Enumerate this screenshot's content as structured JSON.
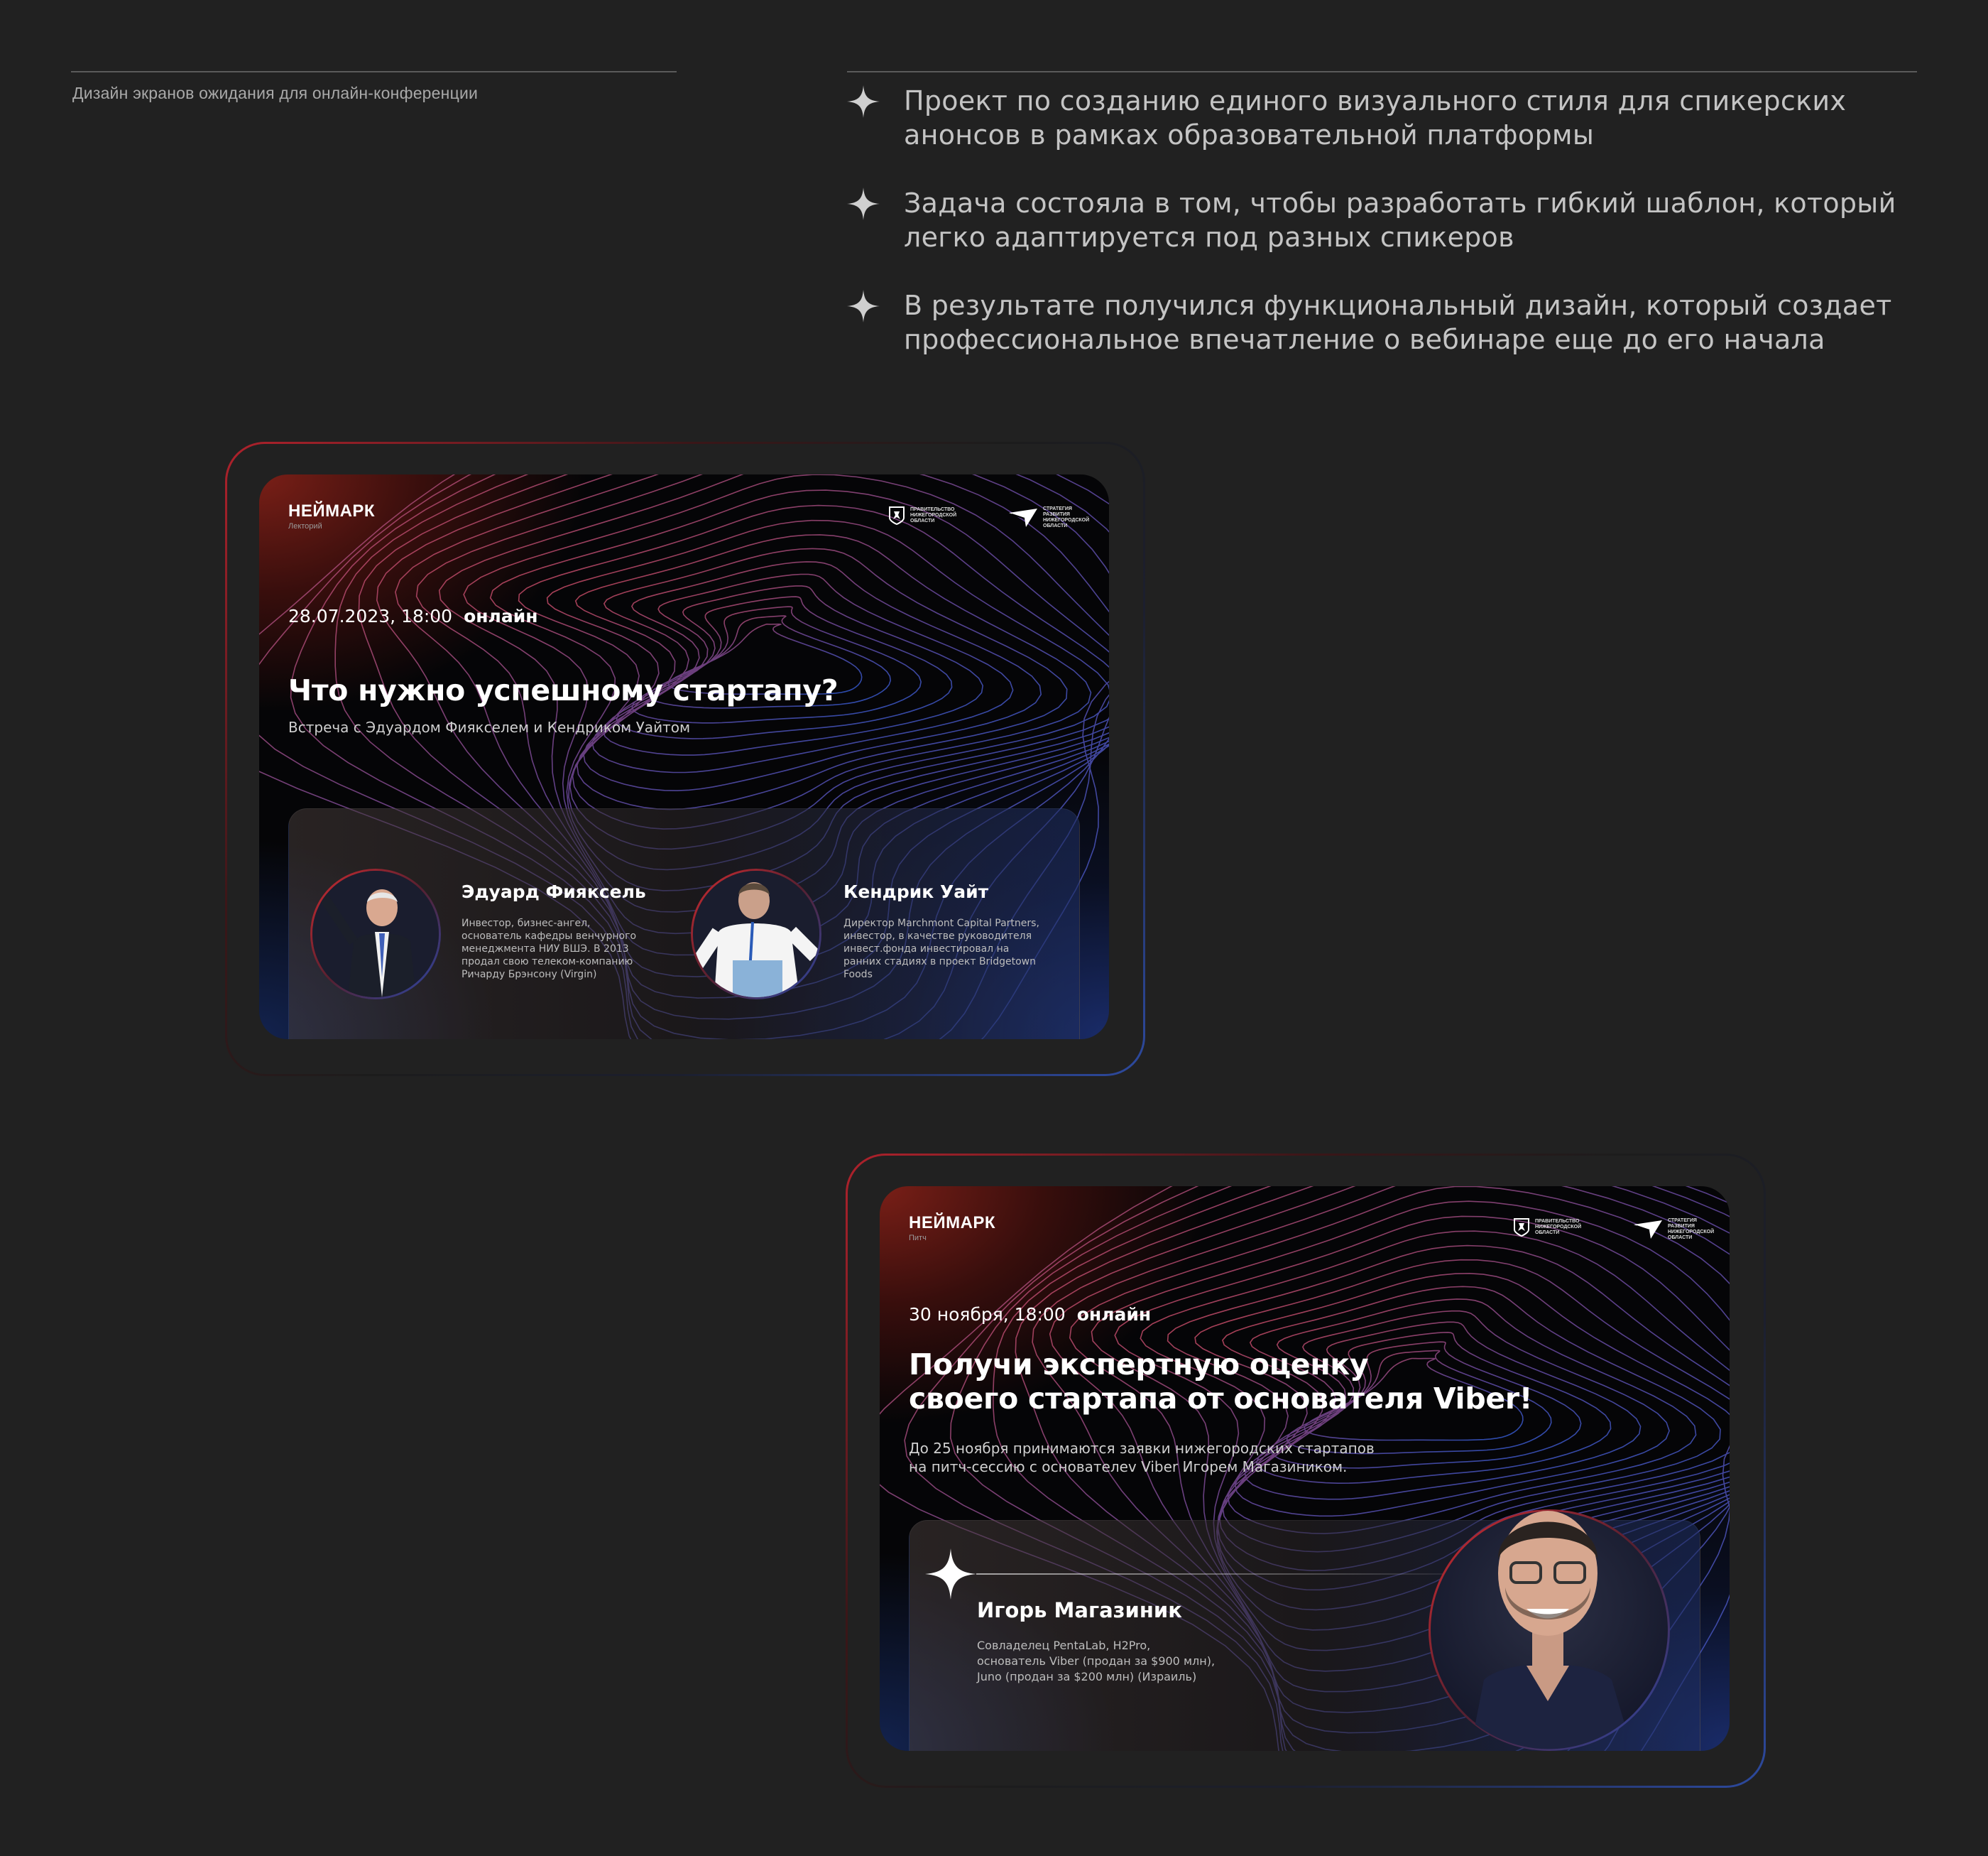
{
  "caption": "Дизайн экранов ожидания для онлайн-конференции",
  "points": [
    "Проект по созданию единого визуального стиля для спикерских анонсов в рамках образовательной платформы",
    "Задача состояла в том, чтобы разработать гибкий шаблон, который легко адаптируется под разных спикеров",
    "В результате получился функциональный дизайн, который создает профессиональное впечатление о вебинаре еще до его начала"
  ],
  "colors": {
    "background": "#212121",
    "accent_red": "#b0222c",
    "accent_blue": "#2d4aa0",
    "card_bg": "#050507"
  },
  "partners": {
    "gov": "ПРАВИТЕЛЬСТВО НИЖЕГОРОДСКОЙ ОБЛАСТИ",
    "strategy": "СТРАТЕГИЯ РАЗВИТИЯ НИЖЕГОРОДСКОЙ ОБЛАСТИ"
  },
  "card1": {
    "brand": "НЕЙМАРК",
    "brand_sub": "Лекторий",
    "date": "28.07.2023, 18:00",
    "mode": "онлайн",
    "title": "Что нужно успешному стартапу?",
    "subtitle": "Встреча с Эдуардом Фиякселем и Кендриком Уайтом",
    "speakers": [
      {
        "name": "Эдуард Фияксель",
        "desc": "Инвестор, бизнес-ангел, основатель кафедры венчурного менеджмента НИУ ВШЭ. В 2013 продал свою телеком-компанию Ричарду Брэнсону (Virgin)"
      },
      {
        "name": "Кендрик Уайт",
        "desc": "Директор Marchmont Capital Partners, инвестор, в качестве руководителя инвест.фонда инвестировал на ранних стадиях в проект Bridgetown Foods"
      }
    ]
  },
  "card2": {
    "brand": "НЕЙМАРК",
    "brand_sub": "Питч",
    "date": "30 ноября, 18:00",
    "mode": "онлайн",
    "title_line1": "Получи экспертную оценку",
    "title_line2": "своего стартапа от основателя Viber!",
    "subtitle_line1": "До 25 ноября принимаются заявки нижегородских стартапов",
    "subtitle_line2": "на питч-сессию с основателеv Viber Игорем Магазиником.",
    "speaker": {
      "name": "Игорь Магазиник",
      "desc_line1": "Совладелец PentaLab, H2Pro,",
      "desc_line2": "основатель Viber (продан за $900 млн),",
      "desc_line3": "Juno (продан за $200 млн) (Израиль)"
    }
  }
}
